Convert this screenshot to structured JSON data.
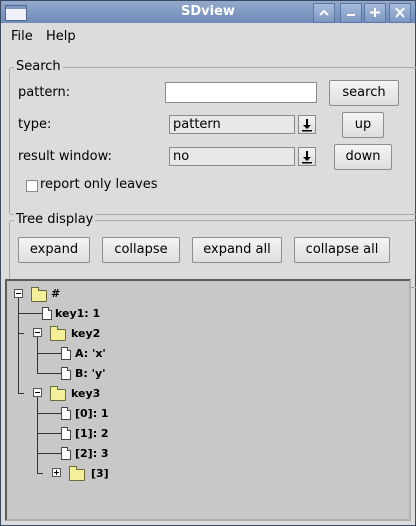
{
  "window": {
    "title": "SDview"
  },
  "menubar": {
    "items": [
      "File",
      "Help"
    ]
  },
  "search": {
    "legend": "Search",
    "pattern_label": "pattern:",
    "pattern_value": "",
    "search_button": "search",
    "type_label": "type:",
    "type_value": "pattern",
    "up_button": "up",
    "result_window_label": "result window:",
    "result_window_value": "no",
    "down_button": "down",
    "report_only_leaves_label": "report only leaves",
    "report_only_leaves_checked": false
  },
  "tree_display": {
    "legend": "Tree display",
    "buttons": [
      "expand",
      "collapse",
      "expand all",
      "collapse all"
    ]
  },
  "tree": [
    {
      "label": "#",
      "type": "folder",
      "expanded": true
    },
    {
      "label": "key1: 1",
      "type": "leaf"
    },
    {
      "label": "key2",
      "type": "folder",
      "expanded": true
    },
    {
      "label": "A: 'x'",
      "type": "leaf"
    },
    {
      "label": "B: 'y'",
      "type": "leaf"
    },
    {
      "label": "key3",
      "type": "folder",
      "expanded": true
    },
    {
      "label": "[0]: 1",
      "type": "leaf"
    },
    {
      "label": "[1]: 2",
      "type": "leaf"
    },
    {
      "label": "[2]: 3",
      "type": "leaf"
    },
    {
      "label": "[3]",
      "type": "folder",
      "expanded": false
    }
  ],
  "icons": {
    "title": [
      "window-app-icon",
      "title-up-icon",
      "minimize-icon",
      "maximize-icon",
      "close-icon"
    ],
    "tree": [
      "folder-icon",
      "document-icon",
      "expander-minus-icon",
      "expander-plus-icon"
    ],
    "combo": "dropdown-arrow-icon"
  }
}
